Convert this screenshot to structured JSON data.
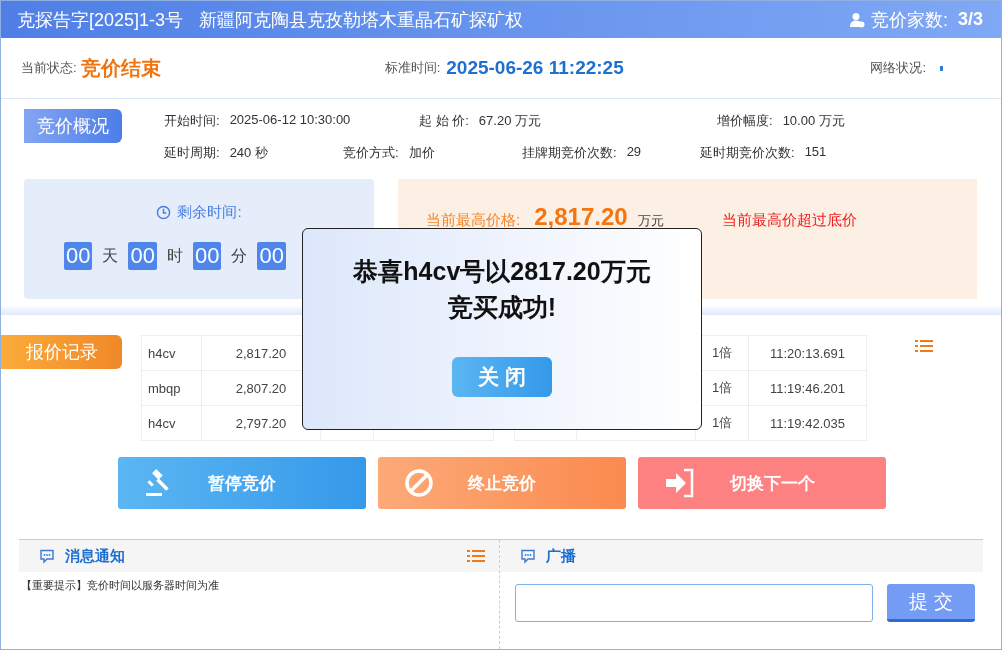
{
  "header": {
    "title": "克探告字[2025]1-3号",
    "subtitle": "新疆阿克陶县克孜勒塔木重晶石矿探矿权",
    "bidders_label": "竞价家数:",
    "bidders_value": "3/3"
  },
  "status": {
    "state_label": "当前状态:",
    "state_value": "竞价结束",
    "time_label": "标准时间:",
    "time_value": "2025-06-26 11:22:25",
    "network_label": "网络状况:"
  },
  "overview": {
    "tag": "竞价概况",
    "fields": [
      {
        "label": "开始时间:",
        "value": "2025-06-12 10:30:00"
      },
      {
        "label": "起 始 价:",
        "value": "67.20 万元"
      },
      {
        "label": "增价幅度:",
        "value": "10.00 万元"
      },
      {
        "label": "延时周期:",
        "value": "240 秒"
      },
      {
        "label": "竞价方式:",
        "value": "加价"
      },
      {
        "label": "挂牌期竞价次数:",
        "value": "29"
      },
      {
        "label": "延时期竞价次数:",
        "value": "151"
      }
    ]
  },
  "countdown": {
    "label": "剩余时间:",
    "units": [
      {
        "value": "00",
        "unit": "天"
      },
      {
        "value": "00",
        "unit": "时"
      },
      {
        "value": "00",
        "unit": "分"
      },
      {
        "value": "00"
      }
    ]
  },
  "highest": {
    "label": "当前最高价格:",
    "value": "2,817.20",
    "unit": "万元",
    "note": "当前最高价超过底价"
  },
  "records": {
    "tag": "报价记录",
    "tables": [
      {
        "rows": [
          [
            "h4cv",
            "2,817.20",
            null,
            null
          ],
          [
            "mbqp",
            "2,807.20",
            null,
            null
          ],
          [
            "h4cv",
            "2,797.20",
            null,
            null
          ]
        ]
      },
      {
        "rows": [
          [
            null,
            null,
            "1倍",
            "11:20:13.691"
          ],
          [
            null,
            null,
            "1倍",
            "11:19:46.201"
          ],
          [
            null,
            null,
            "1倍",
            "11:19:42.035"
          ]
        ]
      }
    ]
  },
  "actions": [
    {
      "label": "暂停竞价",
      "kind": "pause"
    },
    {
      "label": "终止竞价",
      "kind": "stop"
    },
    {
      "label": "切换下一个",
      "kind": "next"
    }
  ],
  "messages": {
    "title": "消息通知",
    "items": [
      "【重要提示】竞价时间以服务器时间为准"
    ]
  },
  "broadcast": {
    "title": "广播",
    "submit": "提 交"
  },
  "modal": {
    "lines": [
      "恭喜h4cv号以2817.20万元",
      "竞买成功!"
    ],
    "close": "关 闭"
  }
}
